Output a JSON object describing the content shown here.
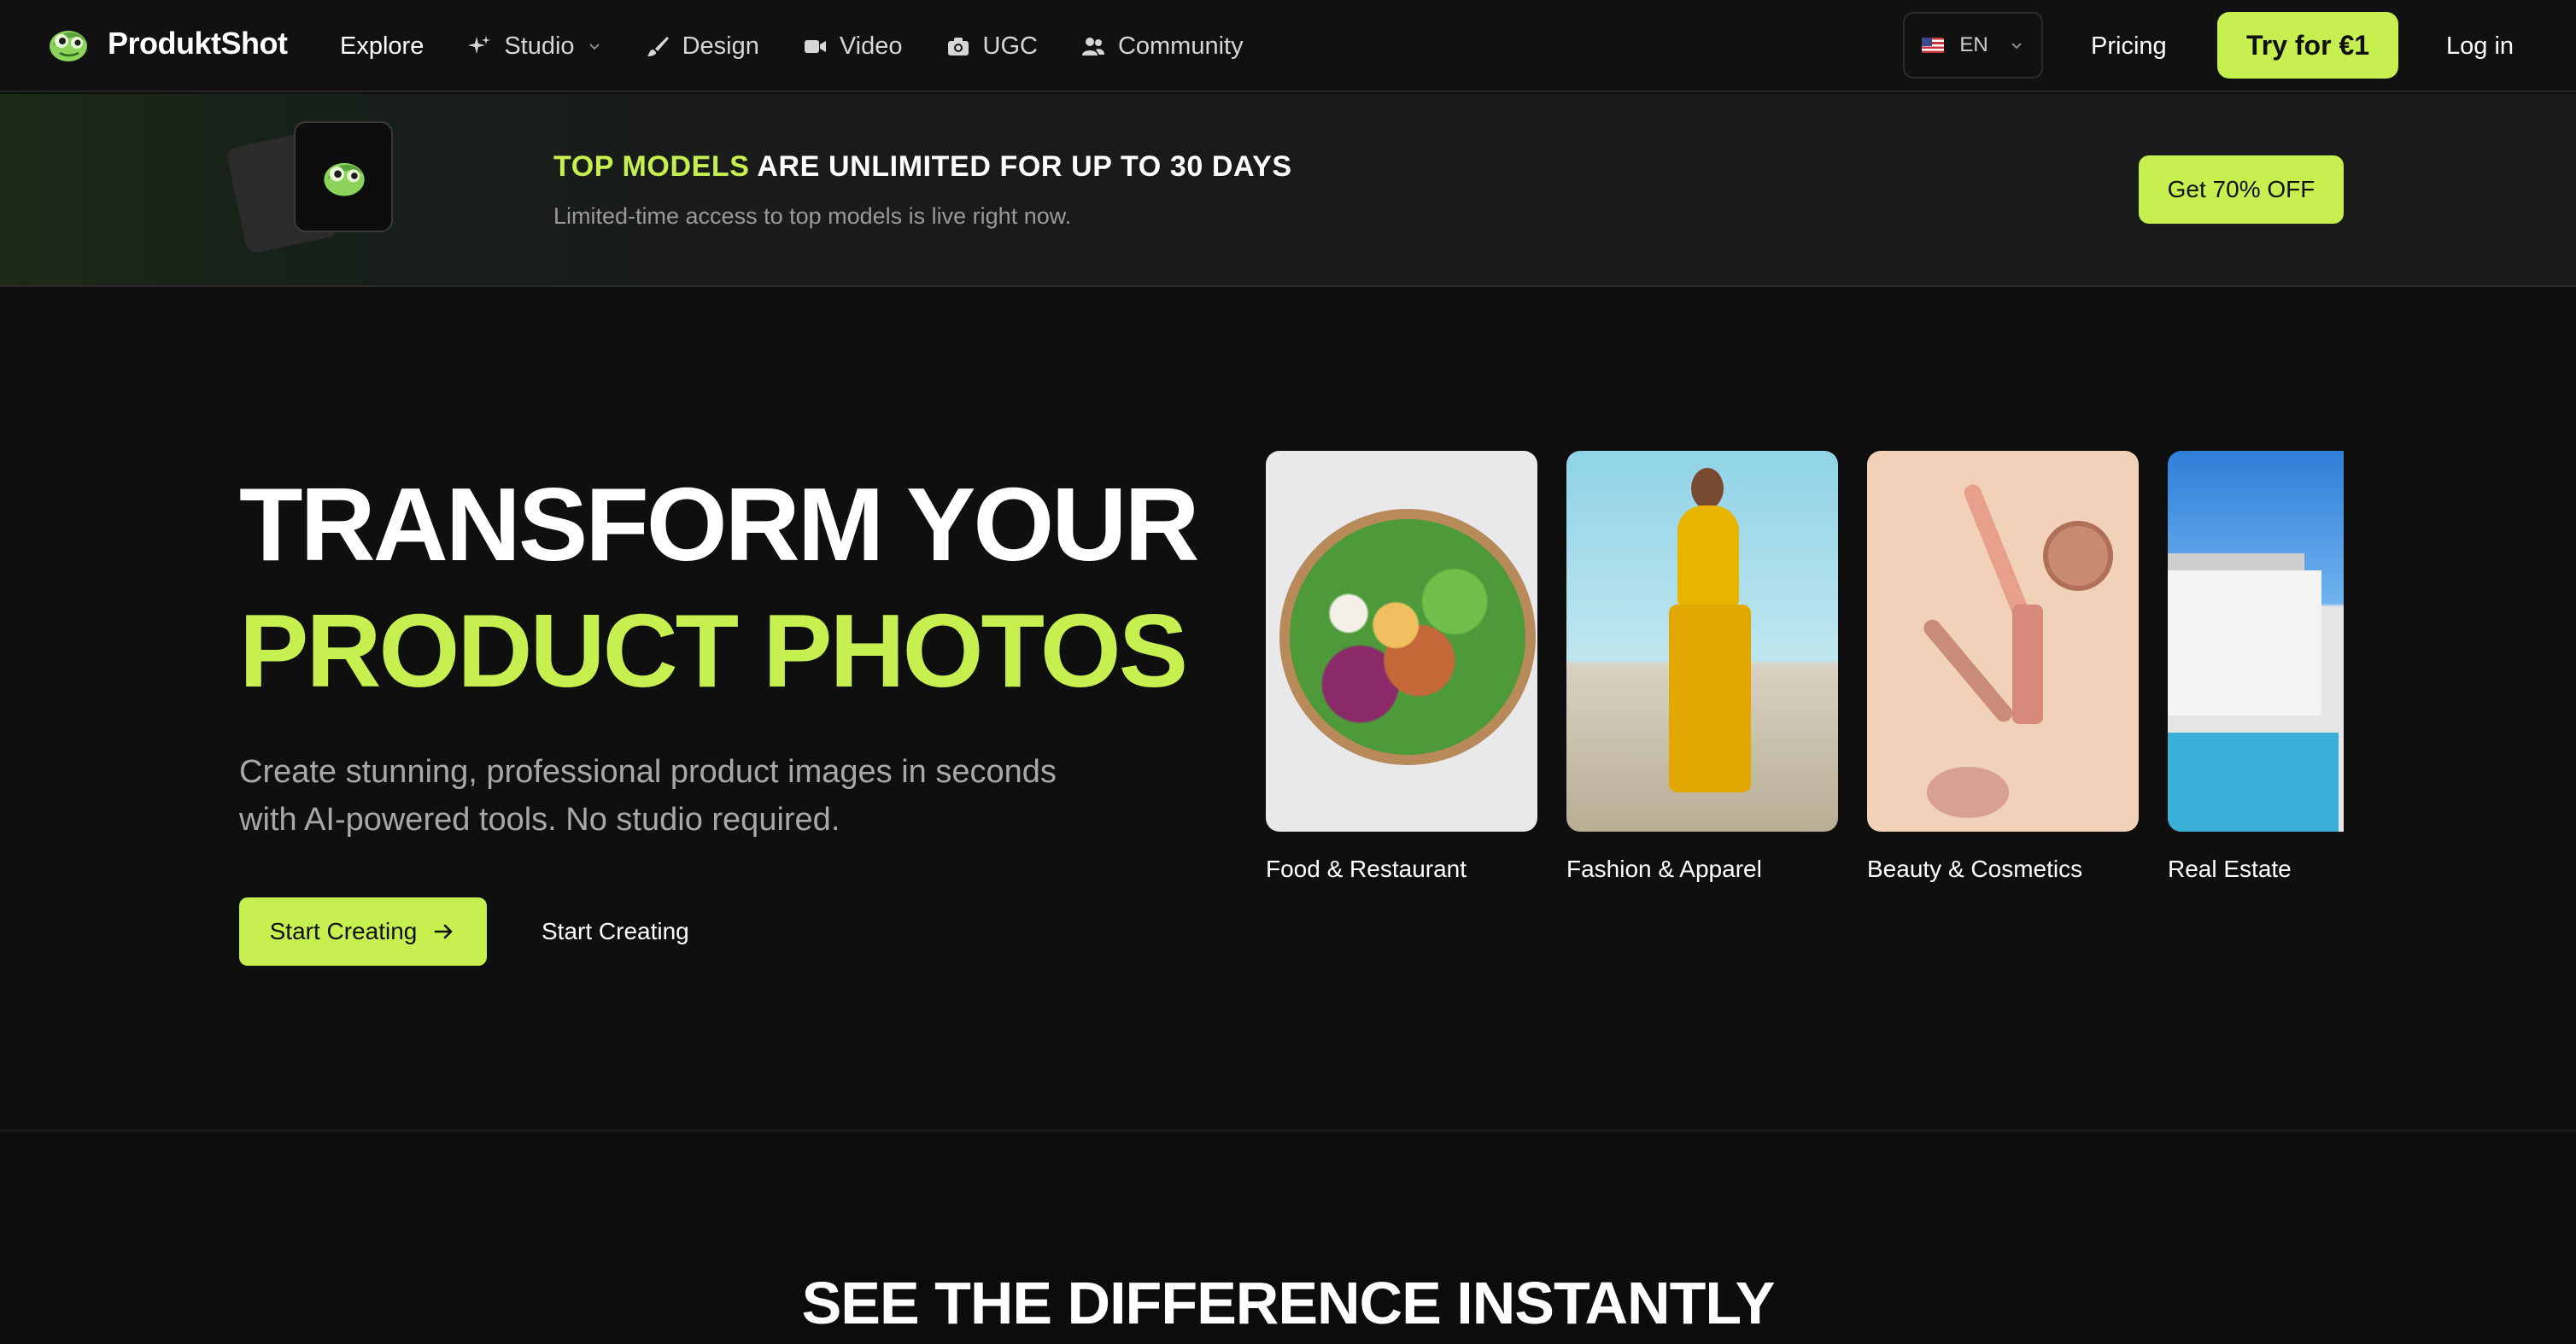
{
  "nav": {
    "brand": "ProduktShot",
    "items": [
      {
        "label": "Explore",
        "icon": ""
      },
      {
        "label": "Studio",
        "icon": "sparkles-icon",
        "dropdown": true
      },
      {
        "label": "Design",
        "icon": "brush-icon"
      },
      {
        "label": "Video",
        "icon": "video-camera-icon"
      },
      {
        "label": "UGC",
        "icon": "camera-icon"
      },
      {
        "label": "Community",
        "icon": "users-icon"
      }
    ],
    "language": "EN",
    "pricing": "Pricing",
    "try_label": "Try for €1",
    "login": "Log in"
  },
  "banner": {
    "title_highlight": "TOP MODELS",
    "title_rest": " ARE UNLIMITED FOR UP TO 30 DAYS",
    "subtitle": "Limited-time access to top models is live right now.",
    "cta": "Get 70% OFF"
  },
  "hero": {
    "title_line1": "TRANSFORM YOUR",
    "title_line2": "PRODUCT PHOTOS",
    "description": "Create stunning, professional product images in seconds with AI-powered tools. No studio required.",
    "cta_primary": "Start Creating",
    "cta_secondary": "Start Creating"
  },
  "categories": [
    {
      "label": "Food & Restaurant"
    },
    {
      "label": "Fashion & Apparel"
    },
    {
      "label": "Beauty & Cosmetics"
    },
    {
      "label": "Real Estate"
    }
  ],
  "section2": {
    "title": "SEE THE DIFFERENCE INSTANTLY"
  },
  "colors": {
    "accent": "#c6f04f",
    "background": "#0f0f0f"
  }
}
